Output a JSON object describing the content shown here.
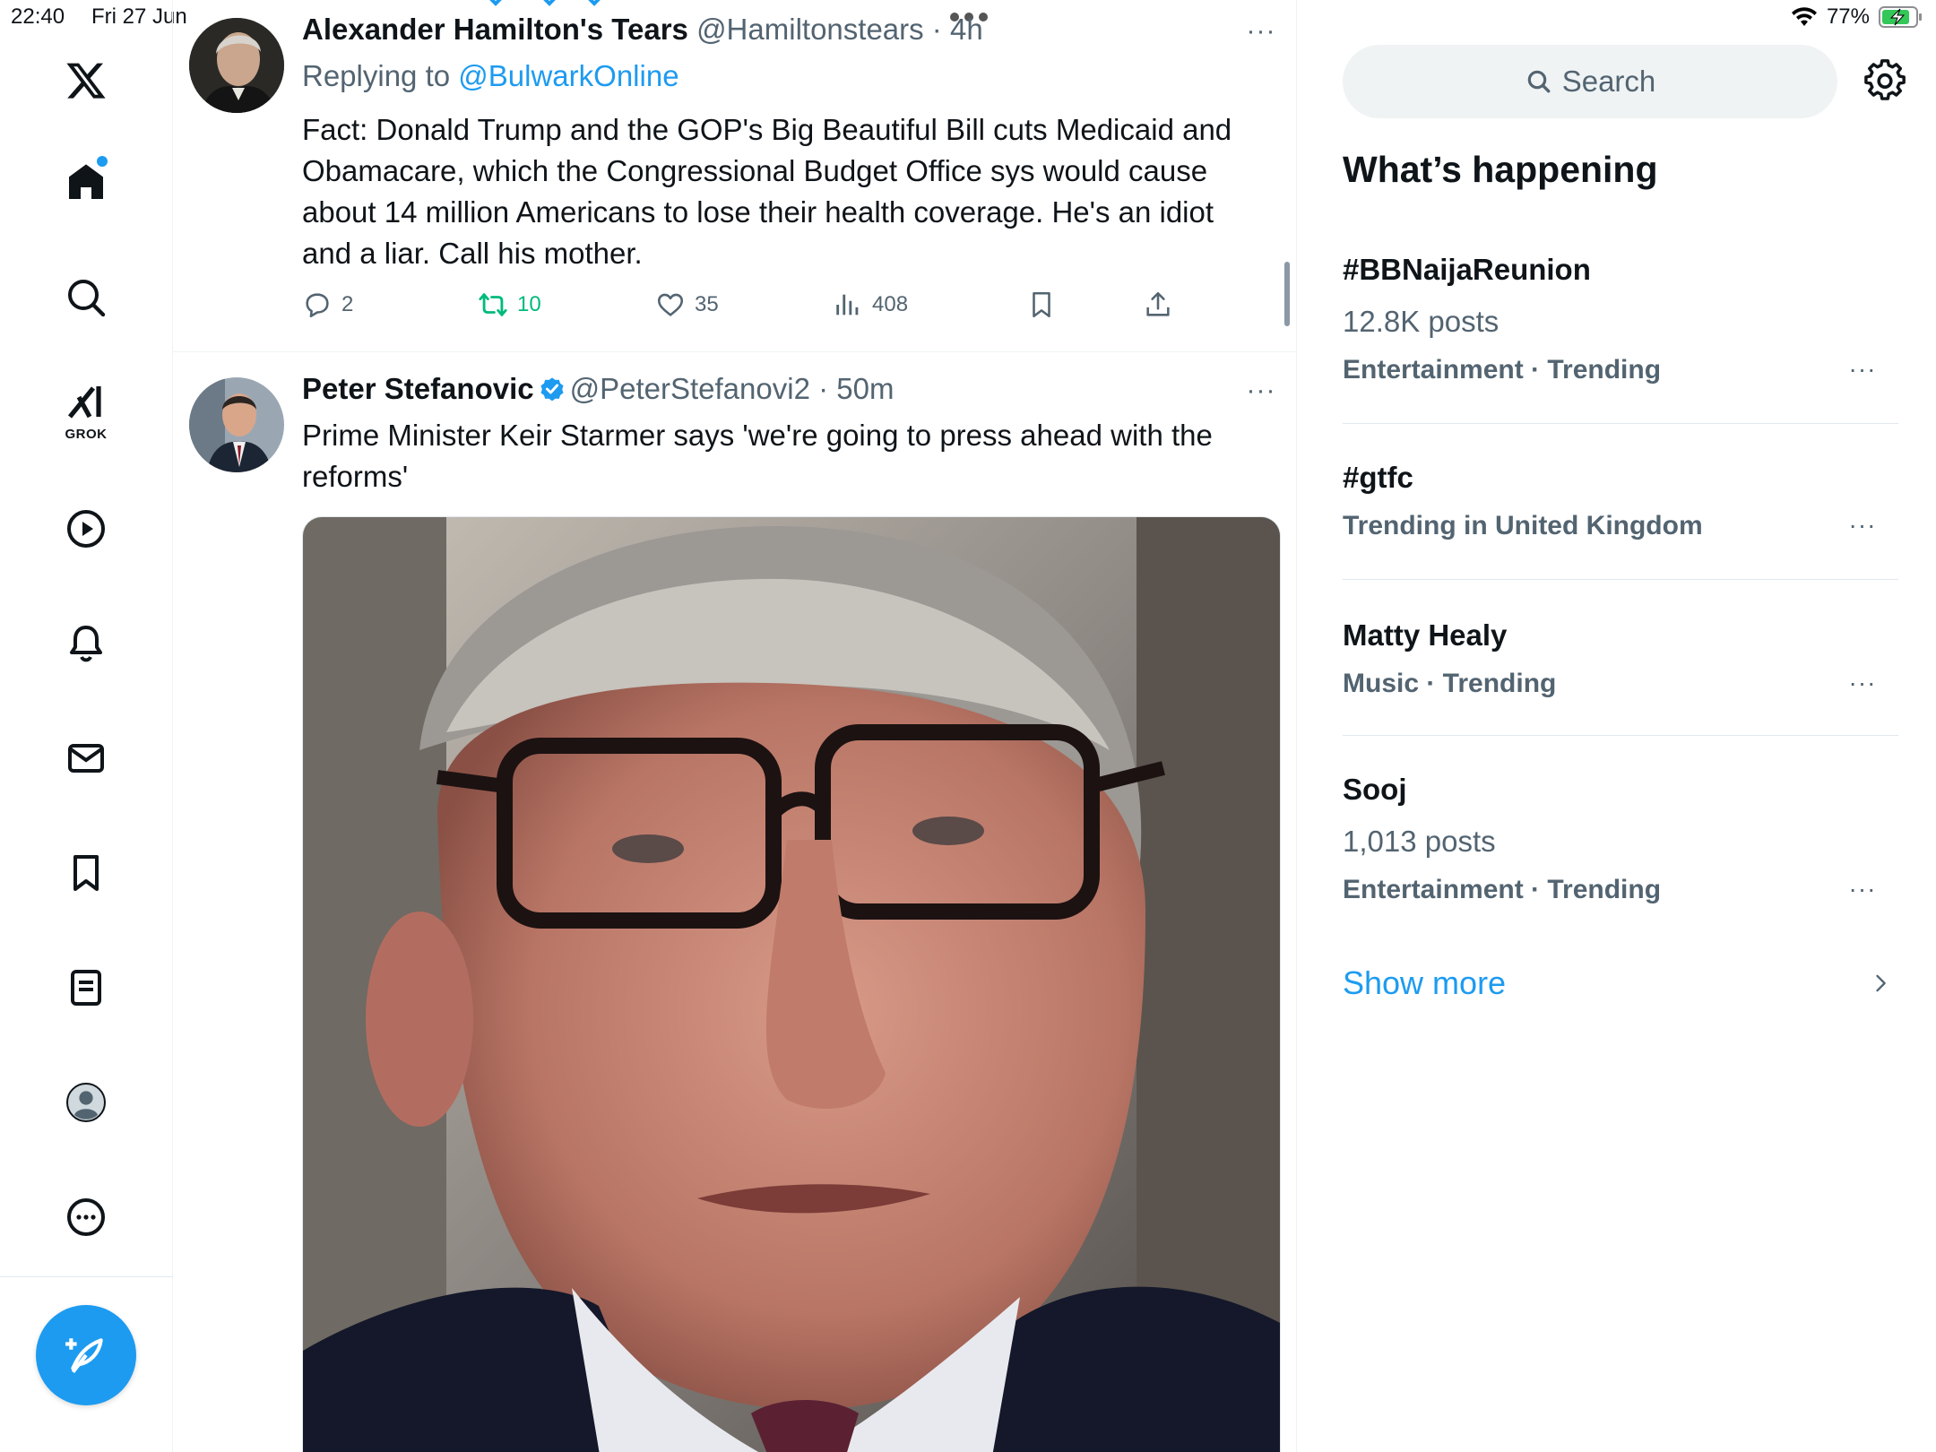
{
  "status_bar": {
    "time": "22:40",
    "date": "Fri 27 Jun",
    "battery": "77%"
  },
  "nav": {
    "grok_label": "GROK",
    "items": [
      "x-logo",
      "home",
      "explore",
      "grok",
      "video",
      "notifications",
      "messages",
      "bookmarks",
      "lists",
      "profile",
      "more"
    ]
  },
  "tweets": [
    {
      "name": "Alexander Hamilton's Tears",
      "handle": "@Hamiltonstears",
      "time": "4h",
      "reply_prefix": "Replying to",
      "reply_to": "@BulwarkOnline",
      "text": "Fact: Donald Trump and the GOP's Big Beautiful Bill  cuts Medicaid and Obamacare, which the Congressional Budget Office sys would cause about 14 million Americans to lose their health coverage.  He's an idiot and a liar.  Call his mother.",
      "replies": "2",
      "retweets": "10",
      "likes": "35",
      "views": "408"
    },
    {
      "name": "Peter Stefanovic",
      "handle": "@PeterStefanovi2",
      "time": "50m",
      "text": "Prime Minister Keir Starmer says 'we're going to press ahead with the reforms'"
    }
  ],
  "sidebar": {
    "search_placeholder": "Search",
    "section_title": "What’s happening",
    "trends": [
      {
        "name": "#BBNaijaReunion",
        "posts": "12.8K posts",
        "meta": "Entertainment · Trending"
      },
      {
        "name": "#gtfc",
        "posts": "",
        "meta": "Trending in United Kingdom"
      },
      {
        "name": "Matty Healy",
        "posts": "",
        "meta": "Music · Trending"
      },
      {
        "name": "Sooj",
        "posts": "1,013 posts",
        "meta": "Entertainment · Trending"
      }
    ],
    "show_more": "Show more"
  },
  "colors": {
    "accent": "#1d9bf0",
    "retweet": "#00ba7c",
    "secondary_text": "#536471",
    "primary_text": "#0f1419"
  }
}
